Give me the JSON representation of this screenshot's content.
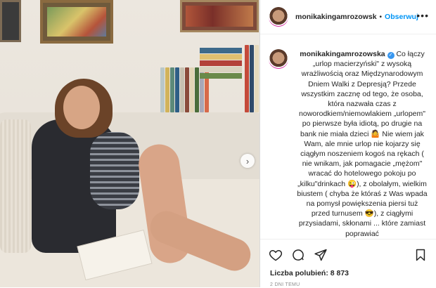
{
  "post": {
    "username_header": "monikakingamrozowsk",
    "follow_label": "Obserwuj",
    "more_label": "•••",
    "separator": "•",
    "next_arrow": "›",
    "caption_username": "monikakingamrozowska",
    "caption_text": " Co łączy „urlop macierzyński\" z wysoką wrażliwością oraz Międzynarodowym Dniem Walki z Depresją? Przede wszystkim zacznę od tego, że osoba, która nazwała czas z noworodkiem/niemowlakiem „urlopem\" po pierwsze była idiotą, po drugie na bank nie miała dzieci 🤷 Nie wiem jak Wam, ale mnie urlop nie kojarzy się ciągłym noszeniem kogoś na rękach ( nie wnikam, jak pomagacie „mężom\" wracać do hotelowego pokoju po „kilku\"drinkach 😜), z obolałym, wielkim biustem ( chyba że któraś z Was wpada na pomysł powiększenia piersi tuż przed turnusem 😎), z ciągłymi przysiadami, skłonami ... które zamiast poprawiać",
    "likes_text": "Liczba polubień: 8 873",
    "timestamp": "2 DNI TEMU"
  },
  "colors": {
    "accent": "#0095f6",
    "verified": "#3897f0",
    "text": "#262626",
    "muted": "#8e8e8e"
  },
  "icons": [
    "heart-icon",
    "comment-icon",
    "share-icon",
    "bookmark-icon",
    "verified-badge-icon",
    "chevron-right-icon"
  ]
}
